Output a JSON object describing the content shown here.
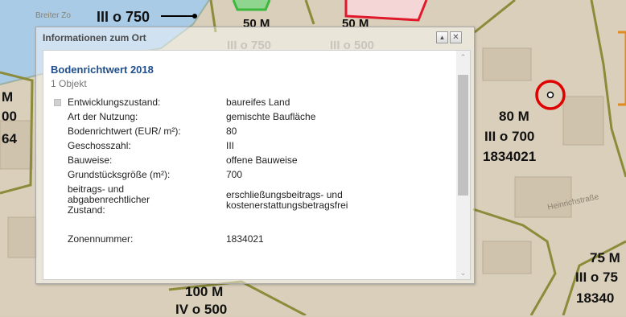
{
  "map": {
    "labels": {
      "top_center": "III o 750",
      "top_50m_a": "50 M",
      "top_50m_b": "50 M",
      "faded_a": "III o 750",
      "faded_b": "III o 500",
      "left_m": "M",
      "left_00": "00",
      "left_64": "64",
      "right_80m": "80 M",
      "right_iii700": "III o 700",
      "right_zone": "1834021",
      "br_75m": "75 M",
      "br_iii75": "III o 75",
      "br_zone": "18340",
      "bottom_100m": "100 M",
      "bottom_iv500": "IV o 500",
      "street_top": "Breiter Zo",
      "street_right": "Heinrichstraße"
    },
    "colors": {
      "zone_border": "#8b8b3a",
      "zone_fill": "#d8cdb8",
      "river": "#a9cbe6",
      "highlight_circle": "#e00000",
      "red_area": "#e0182b",
      "green_area": "#3cb83c"
    }
  },
  "popup": {
    "title": "Informationen zum Ort",
    "collapse_icon": "▲",
    "close_icon": "✕",
    "result_title": "Bodenrichtwert 2018",
    "result_count": "1 Objekt",
    "attributes": [
      {
        "key": "Entwicklungszustand:",
        "value": "baureifes Land"
      },
      {
        "key": "Art der Nutzung:",
        "value": "gemischte Baufläche"
      },
      {
        "key": "Bodenrichtwert (EUR/ m²):",
        "value": "80"
      },
      {
        "key": "Geschosszahl:",
        "value": "III"
      },
      {
        "key": "Bauweise:",
        "value": "offene Bauweise"
      },
      {
        "key": "Grundstücksgröße (m²):",
        "value": "700"
      },
      {
        "key": "beitrags- und abgabenrechtlicher Zustand:",
        "value": "erschließungsbeitrags- und kostenerstattungsbetragsfrei"
      },
      {
        "key": "Zonennummer:",
        "value": "1834021"
      }
    ]
  }
}
